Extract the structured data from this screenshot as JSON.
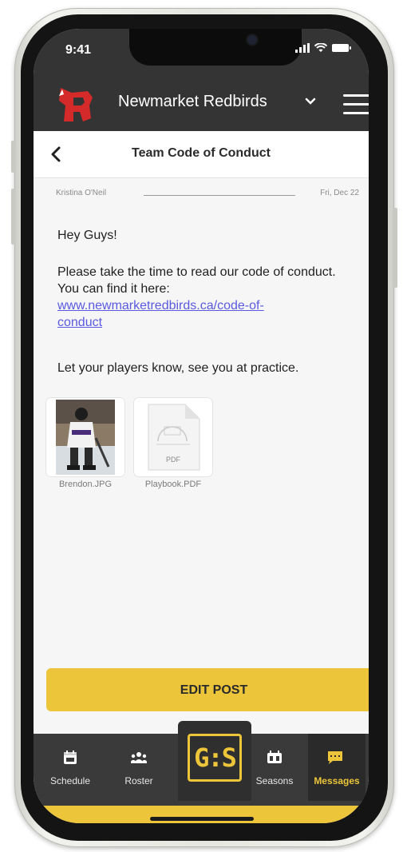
{
  "status_bar": {
    "time": "9:41",
    "icons": [
      "cellular-signal-icon",
      "wifi-icon",
      "battery-icon"
    ]
  },
  "team_header": {
    "team_name": "Newmarket Redbirds",
    "logo_icon": "redbird-logo-icon",
    "switch_icon": "chevron-down-icon",
    "menu_icon": "hamburger-menu-icon"
  },
  "title_bar": {
    "back_icon": "back-chevron-icon",
    "title": "Team Code of Conduct"
  },
  "post": {
    "author": "Kristina O'Neil",
    "date": "Fri, Dec 22",
    "greeting": "Hey Guys!",
    "body": "Please take the time to read our code of conduct. You can find it here:",
    "link_line1": "www.newmarketredbirds.ca/code-of-",
    "link_line2": "conduct",
    "closing": "Let your players know, see you at practice.",
    "attachments": [
      {
        "name": "Brendon.JPG",
        "kind": "photo"
      },
      {
        "name": "Playbook.PDF",
        "kind": "pdf",
        "badge": "PDF"
      }
    ]
  },
  "actions": {
    "edit_label": "EDIT POST"
  },
  "tab_bar": {
    "tabs": [
      {
        "label": "Schedule",
        "icon": "calendar-icon"
      },
      {
        "label": "Roster",
        "icon": "team-icon"
      },
      {
        "label": "Seasons",
        "icon": "scoreboard-icon"
      },
      {
        "label": "Messages",
        "icon": "chat-icon",
        "active": true
      }
    ],
    "center_logo": "G:S"
  },
  "colors": {
    "accent_yellow": "#ecc53a",
    "header_dark": "#343434",
    "tab_bar_dark": "#3a3a3a",
    "link_blue": "#5a5ae0",
    "team_red": "#d42a2a"
  }
}
